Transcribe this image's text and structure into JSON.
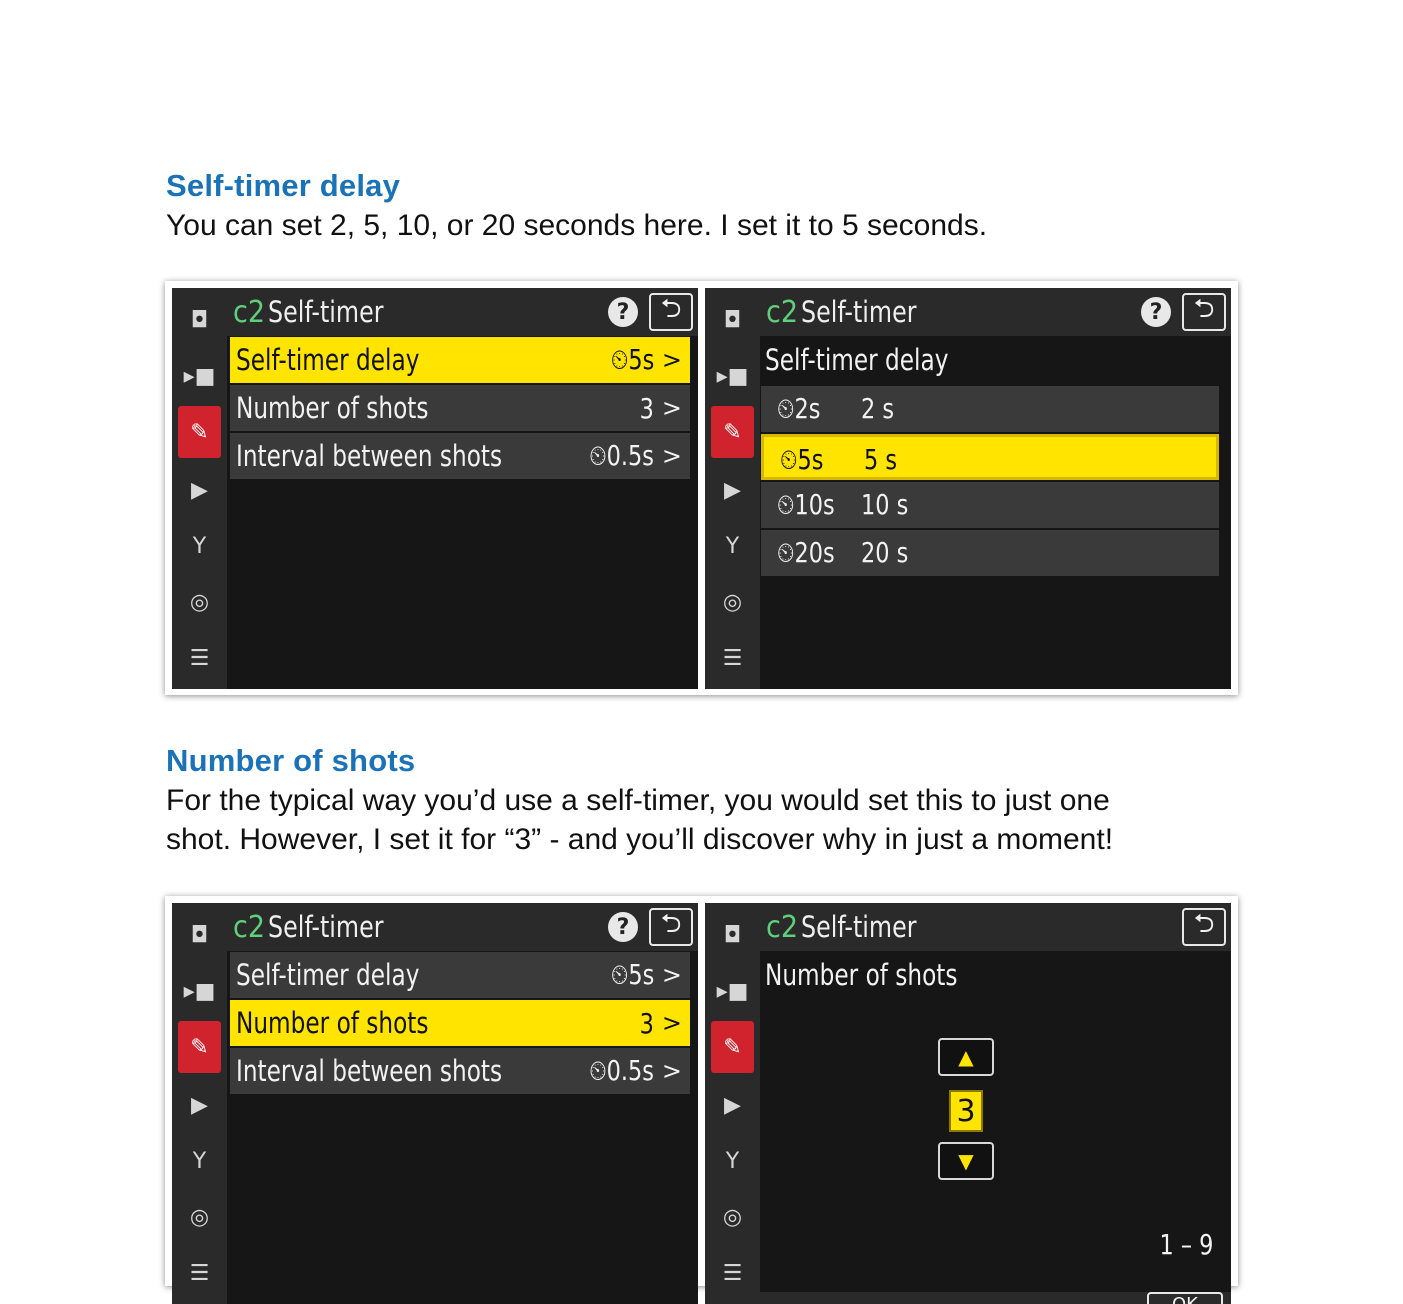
{
  "sections": [
    {
      "heading": "Self-timer delay",
      "text": "You can set 2, 5, 10, or 20 seconds here. I set it to 5 seconds."
    },
    {
      "heading": "Number of shots",
      "text_line1": "For the typical way you’d use a self-timer, you would set this to just one",
      "text_line2": "shot. However, I set it for “3” - and you’ll discover why in just a moment!"
    }
  ],
  "camera": {
    "menu_code": "c2",
    "menu_title": "Self-timer",
    "help_symbol": "?",
    "back_symbol": "⮌",
    "sidebar_icons": [
      "camera-icon",
      "movie-camera-icon",
      "pencil-icon",
      "playback-icon",
      "wrench-icon",
      "network-icon",
      "my-menu-icon"
    ],
    "menu_items": [
      {
        "label": "Self-timer delay",
        "value": "⏲5s"
      },
      {
        "label": "Number of shots",
        "value": "3"
      },
      {
        "label": "Interval between shots",
        "value": "⏲0.5s"
      }
    ],
    "delay_screen": {
      "heading": "Self-timer delay",
      "options": [
        {
          "icon": "⏲2s",
          "label": "2 s"
        },
        {
          "icon": "⏲5s",
          "label": "5 s"
        },
        {
          "icon": "⏲10s",
          "label": "10 s"
        },
        {
          "icon": "⏲20s",
          "label": "20 s"
        }
      ],
      "selected_index": 1
    },
    "shots_screen": {
      "heading": "Number of shots",
      "value": "3",
      "up_symbol": "▲",
      "down_symbol": "▼",
      "range": "1 – 9",
      "ok_label": "OK"
    },
    "chevron": ">",
    "colors": {
      "highlight": "#ffe400",
      "active_tab": "#d0232d",
      "heading_blue": "#1a73b9"
    }
  }
}
